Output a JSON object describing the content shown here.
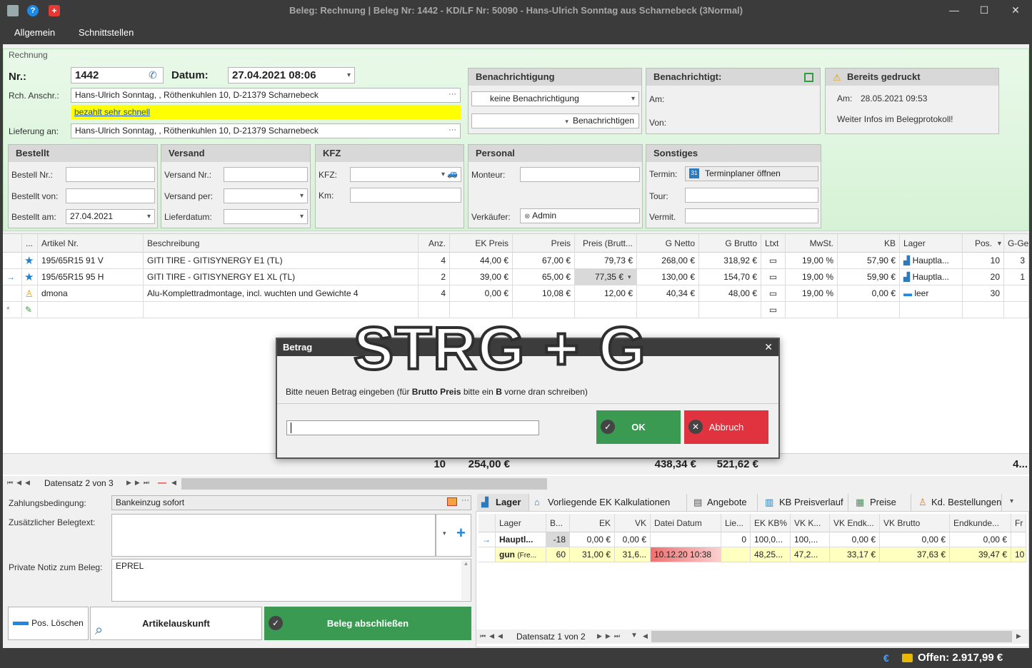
{
  "window": {
    "title": "Beleg: Rechnung | Beleg Nr: 1442 -  KD/LF Nr: 50090 -  Hans-Ulrich Sonntag  aus Scharnebeck (3Normal)"
  },
  "menu": [
    "Allgemein",
    "Schnittstellen"
  ],
  "rechnung": {
    "legend": "Rechnung",
    "nr_label": "Nr.:",
    "nr_value": "1442",
    "datum_label": "Datum:",
    "datum_value": "27.04.2021 08:06",
    "anschr_label": "Rch. Anschr.:",
    "anschr_value": "Hans-Ulrich Sonntag, , Röthenkuhlen 10,  D-21379 Scharnebeck",
    "note_link": "bezahlt sehr schnell",
    "lieferung_label": "Lieferung an:",
    "lieferung_value": "Hans-Ulrich Sonntag, , Röthenkuhlen 10,  D-21379 Scharnebeck"
  },
  "benachrichtigung": {
    "title": "Benachrichtigung",
    "select": "keine Benachrichtigung",
    "button": "Benachrichtigen"
  },
  "benachrichtigt": {
    "title": "Benachrichtigt:",
    "am": "Am:",
    "von": "Von:"
  },
  "gedruckt": {
    "title": "Bereits gedruckt",
    "am_label": "Am:",
    "am_value": "28.05.2021 09:53",
    "info": "Weiter Infos im Belegprotokoll!"
  },
  "bestellt": {
    "title": "Bestellt",
    "nr": "Bestell Nr.:",
    "von": "Bestellt von:",
    "am": "Bestellt am:",
    "am_value": "27.04.2021"
  },
  "versand": {
    "title": "Versand",
    "nr": "Versand Nr.:",
    "per": "Versand per:",
    "datum": "Lieferdatum:"
  },
  "kfz": {
    "title": "KFZ",
    "kfz": "KFZ:",
    "km": "Km:"
  },
  "personal": {
    "title": "Personal",
    "monteur": "Monteur:",
    "verkaeufer": "Verkäufer:",
    "verkaeufer_value": "Admin"
  },
  "sonstiges": {
    "title": "Sonstiges",
    "termin": "Termin:",
    "termin_button": "Terminplaner öffnen",
    "tour": "Tour:",
    "vermit": "Vermit."
  },
  "grid": {
    "headers": [
      "...",
      "Artikel Nr.",
      "Beschreibung",
      "Anz.",
      "EK Preis",
      "Preis",
      "Preis (Brutt...",
      "G Netto",
      "G Brutto",
      "Ltxt",
      "MwSt.",
      "KB",
      "Lager",
      "Pos.",
      "G-Ge"
    ],
    "rows": [
      [
        "195/65R15 91 V",
        "GITI TIRE - GITISYNERGY E1 (TL)",
        "4",
        "44,00 €",
        "67,00 €",
        "79,73 €",
        "268,00 €",
        "318,92 €",
        "19,00 %",
        "57,90 €",
        "Hauptla...",
        "10",
        "3"
      ],
      [
        "195/65R15 95 H",
        "GITI TIRE - GITISYNERGY E1 XL (TL)",
        "2",
        "39,00 €",
        "65,00 €",
        "77,35 €",
        "130,00 €",
        "154,70 €",
        "19,00 %",
        "59,90 €",
        "Hauptla...",
        "20",
        "1"
      ],
      [
        "dmona",
        "Alu-Komplettradmontage, incl. wuchten und Gewichte 4",
        "4",
        "0,00 €",
        "10,08 €",
        "12,00 €",
        "40,34 €",
        "48,00 €",
        "19,00 %",
        "0,00 €",
        "leer",
        "30",
        ""
      ]
    ],
    "sum": {
      "anz": "10",
      "ek": "254,00 €",
      "netto": "438,34 €",
      "brutto": "521,62 €",
      "gge": "4..."
    },
    "nav": "Datensatz 2 von 3"
  },
  "overlay_text": "STRG + G",
  "dialog": {
    "title": "Betrag",
    "prompt_pre": "Bitte neuen Betrag eingeben (für ",
    "prompt_b1": "Brutto Preis",
    "prompt_mid": " bitte ein ",
    "prompt_b2": "B",
    "prompt_post": " vorne dran schreiben)",
    "ok": "OK",
    "cancel": "Abbruch"
  },
  "bottom": {
    "zahlung_label": "Zahlungsbedingung:",
    "zahlung_value": "Bankeinzug sofort",
    "belegtext_label": "Zusätzlicher Belegtext:",
    "notiz_label": "Private Notiz zum Beleg:",
    "notiz_value": "EPREL",
    "pos_loeschen": "Pos. Löschen",
    "artikelauskunft": "Artikelauskunft",
    "abschliessen": "Beleg abschließen"
  },
  "tabs": [
    "Lager",
    "Vorliegende EK Kalkulationen",
    "Angebote",
    "KB Preisverlauf",
    "Preise",
    "Kd. Bestellungen"
  ],
  "lager": {
    "headers": [
      "Lager",
      "B...",
      "EK",
      "VK",
      "Datei Datum",
      "Lie...",
      "EK KB%",
      "VK K...",
      "VK Endk...",
      "VK Brutto",
      "Endkunde...",
      "Fr"
    ],
    "rows": [
      [
        "Hauptl...",
        "-18",
        "0,00 €",
        "0,00 €",
        "",
        "0",
        "100,0...",
        "100,...",
        "0,00 €",
        "0,00 €",
        "0,00 €",
        ""
      ],
      [
        "gun",
        "60",
        "31,00 €",
        "31,6...",
        "10.12.20 10:38",
        "",
        "48,25...",
        "47,2...",
        "33,17 €",
        "37,63 €",
        "39,47 €",
        "10"
      ]
    ],
    "row2_suffix": "(Fre...",
    "nav": "Datensatz 1 von 2"
  },
  "status": {
    "offen": "Offen: 2.917,99 €"
  }
}
